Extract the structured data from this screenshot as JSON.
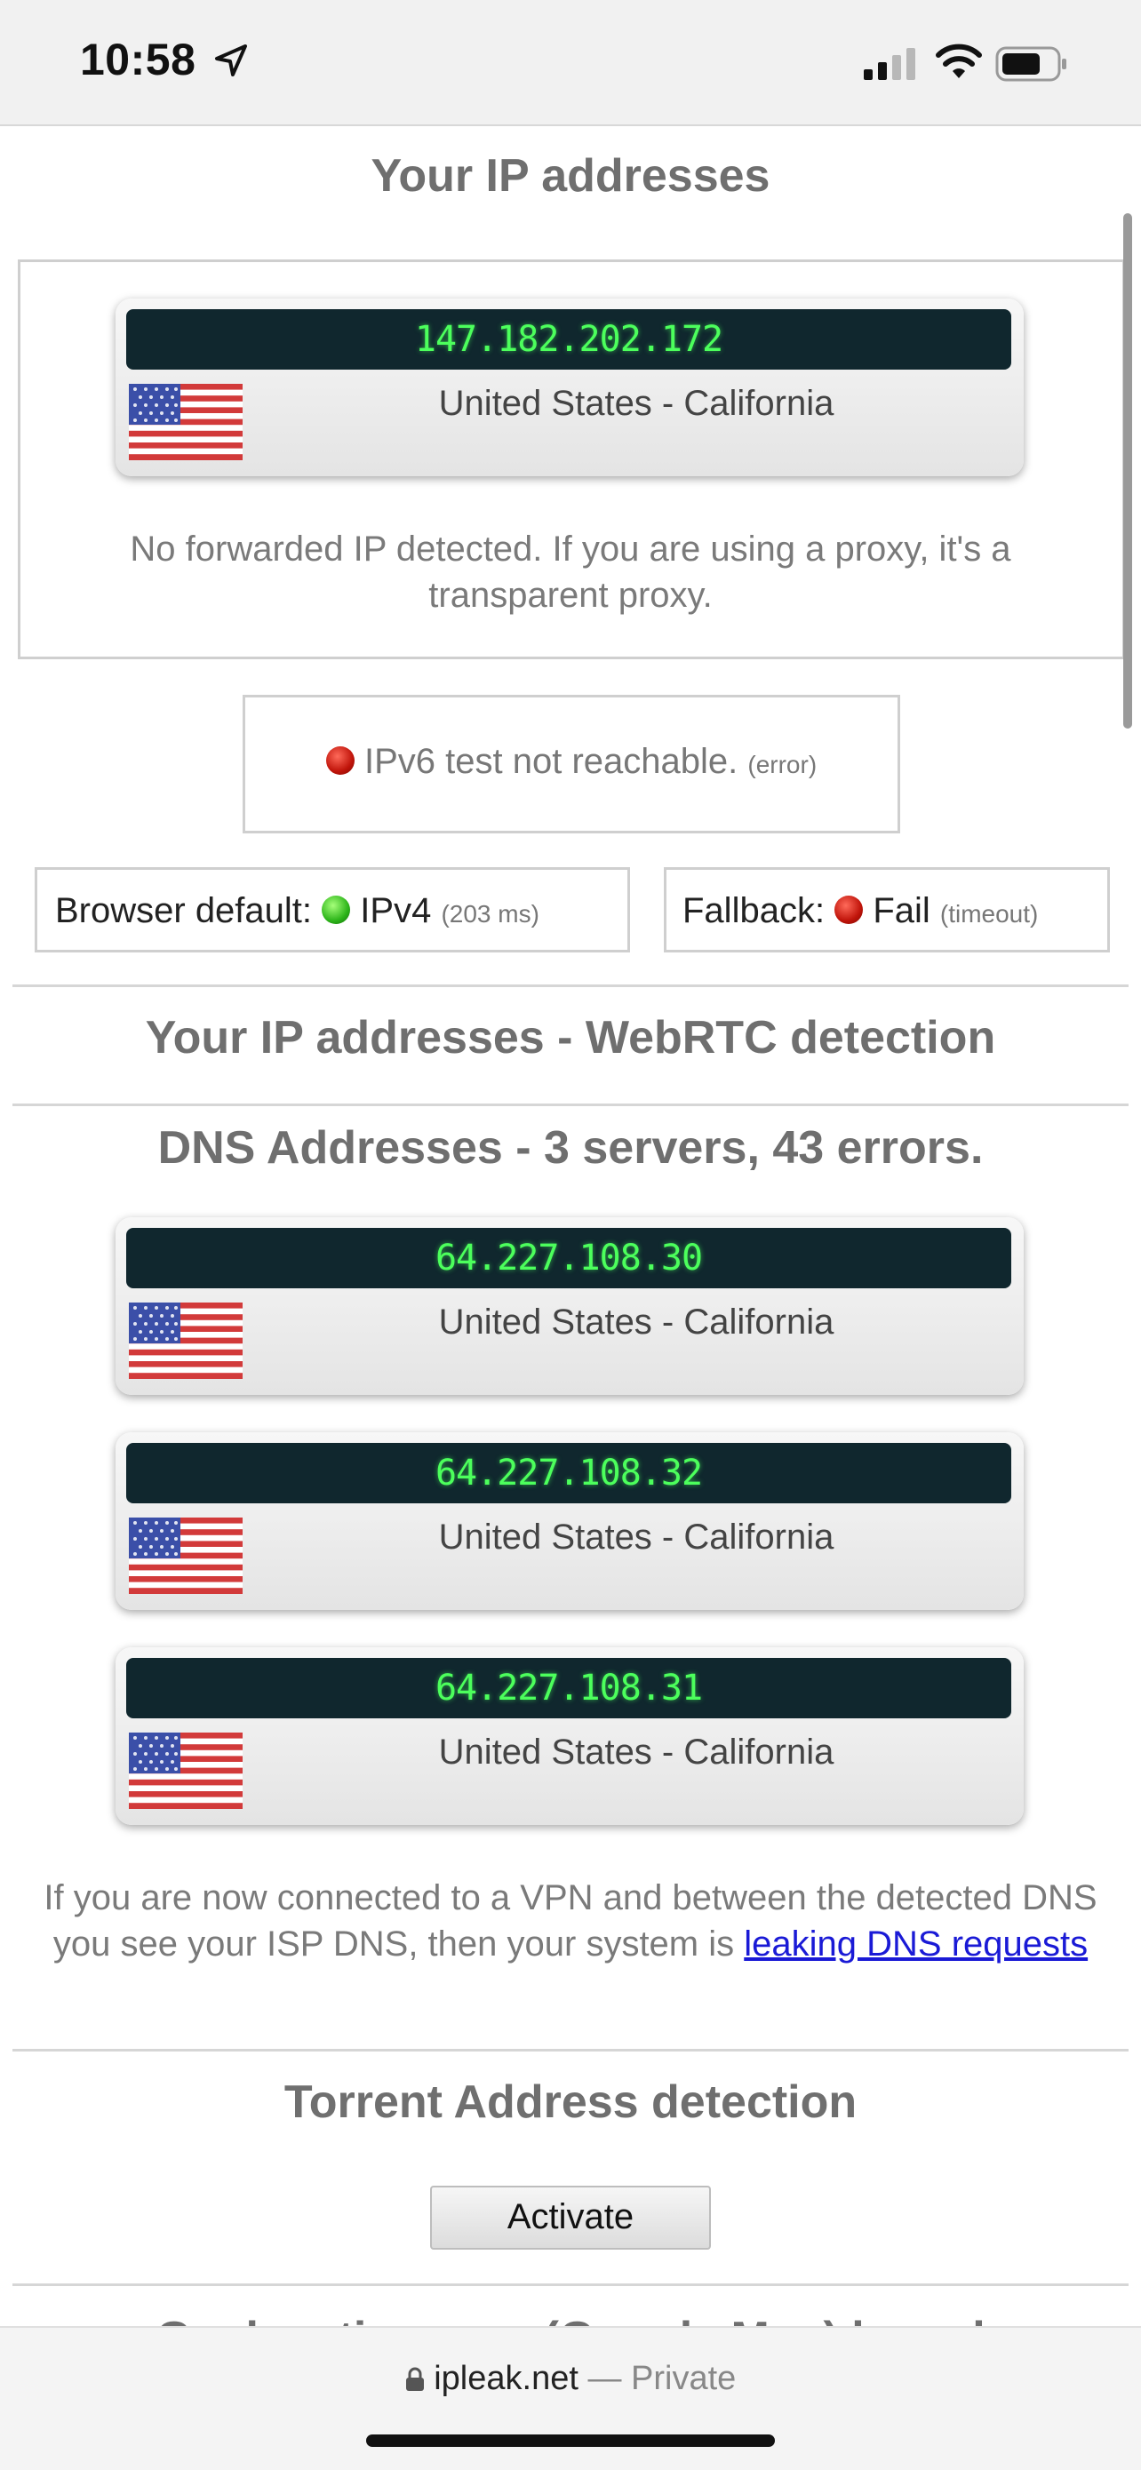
{
  "status_bar": {
    "time": "10:58",
    "location_icon": "location-arrow-icon",
    "signal_icon": "cell-signal-icon",
    "wifi_icon": "wifi-icon",
    "battery_icon": "battery-icon"
  },
  "ip_section": {
    "title": "Your IP addresses",
    "ip": {
      "address": "147.182.202.172",
      "location": "United States - California",
      "flag": "us-flag-icon"
    },
    "forwarded_note": "No forwarded IP detected. If you are using a proxy, it's a transparent proxy.",
    "ipv6": {
      "text": "IPv6 test not reachable.",
      "detail": "(error)"
    },
    "browser_default": {
      "label": "Browser default:",
      "value": "IPv4",
      "detail": "(203 ms)"
    },
    "fallback": {
      "label": "Fallback:",
      "value": "Fail",
      "detail": "(timeout)"
    }
  },
  "webrtc_section": {
    "title": "Your IP addresses - WebRTC detection"
  },
  "dns_section": {
    "title": "DNS Addresses - 3 servers, 43 errors.",
    "servers": [
      {
        "address": "64.227.108.30",
        "location": "United States - California"
      },
      {
        "address": "64.227.108.32",
        "location": "United States - California"
      },
      {
        "address": "64.227.108.31",
        "location": "United States - California"
      }
    ],
    "note_text": "If you are now connected to a VPN and between the detected DNS you see your ISP DNS, then your system is ",
    "note_link": "leaking DNS requests"
  },
  "torrent_section": {
    "title": "Torrent Address detection",
    "button": "Activate"
  },
  "next_section_partial": "Geolocation map (Google Map) based",
  "browser": {
    "domain": "ipleak.net",
    "separator": " — ",
    "mode": "Private",
    "lock_icon": "lock-icon"
  },
  "colors": {
    "ip_bar_bg": "#10272e",
    "ip_text": "#4cff5c",
    "status_red": "#c0140a",
    "status_green": "#2db51a",
    "link": "#1a1ad6"
  }
}
